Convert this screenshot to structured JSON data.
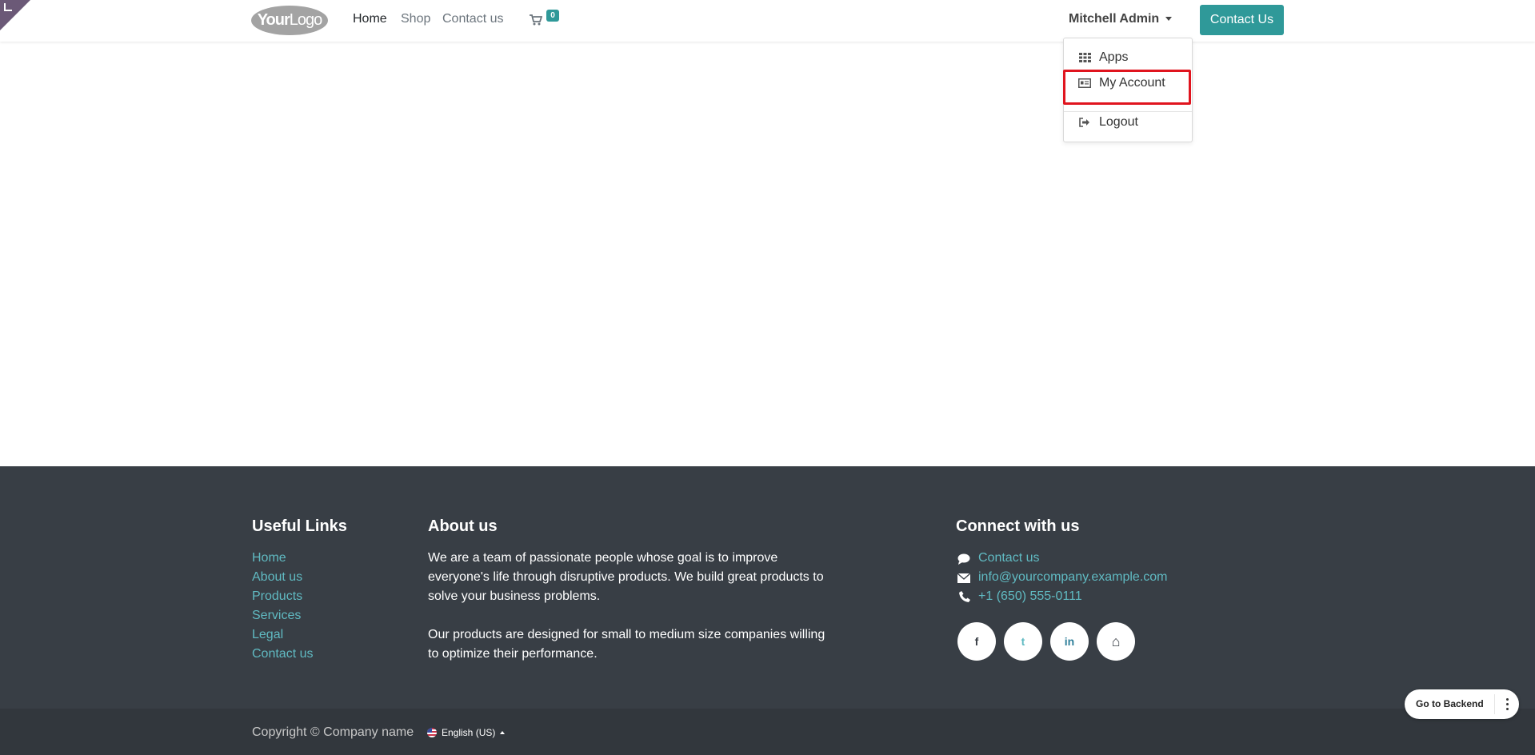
{
  "header": {
    "logo": {
      "part1": "Your",
      "part2": "Logo"
    },
    "nav": [
      {
        "label": "Home",
        "active": true
      },
      {
        "label": "Shop",
        "active": false
      },
      {
        "label": "Contact us",
        "active": false
      }
    ],
    "cart_count": "0",
    "user_name": "Mitchell Admin",
    "contact_button": "Contact Us"
  },
  "user_dropdown": {
    "items": [
      {
        "label": "Apps",
        "icon": "apps-grid-icon"
      },
      {
        "label": "My Account",
        "icon": "id-card-icon"
      },
      {
        "label": "Logout",
        "icon": "sign-out-icon"
      }
    ]
  },
  "footer": {
    "useful_links": {
      "title": "Useful Links",
      "links": [
        "Home",
        "About us",
        "Products",
        "Services",
        "Legal",
        "Contact us"
      ]
    },
    "about": {
      "title": "About us",
      "lines1": [
        "We are a team of passionate people whose goal is to improve",
        "everyone's life through disruptive products. We build great products to",
        "solve your business problems."
      ],
      "lines2": [
        "Our products are designed for small to medium size companies willing",
        "to optimize their performance."
      ]
    },
    "connect": {
      "title": "Connect with us",
      "items": [
        {
          "label": "Contact us",
          "icon": "comment-icon"
        },
        {
          "label": "info@yourcompany.example.com",
          "icon": "envelope-icon"
        },
        {
          "label": "+1 (650) 555-0111",
          "icon": "phone-icon"
        }
      ],
      "social": [
        {
          "name": "facebook",
          "glyph": "f"
        },
        {
          "name": "twitter",
          "glyph": "t"
        },
        {
          "name": "linkedin",
          "glyph": "in"
        },
        {
          "name": "home",
          "glyph": "⌂"
        }
      ]
    }
  },
  "copyright": {
    "text": "Copyright © Company name",
    "language": "English (US)"
  },
  "backend_button": {
    "label": "Go to Backend"
  },
  "colors": {
    "accent": "#2f9999",
    "footer_bg": "#383e45",
    "link": "#60bac2",
    "highlight": "#e0141e"
  }
}
